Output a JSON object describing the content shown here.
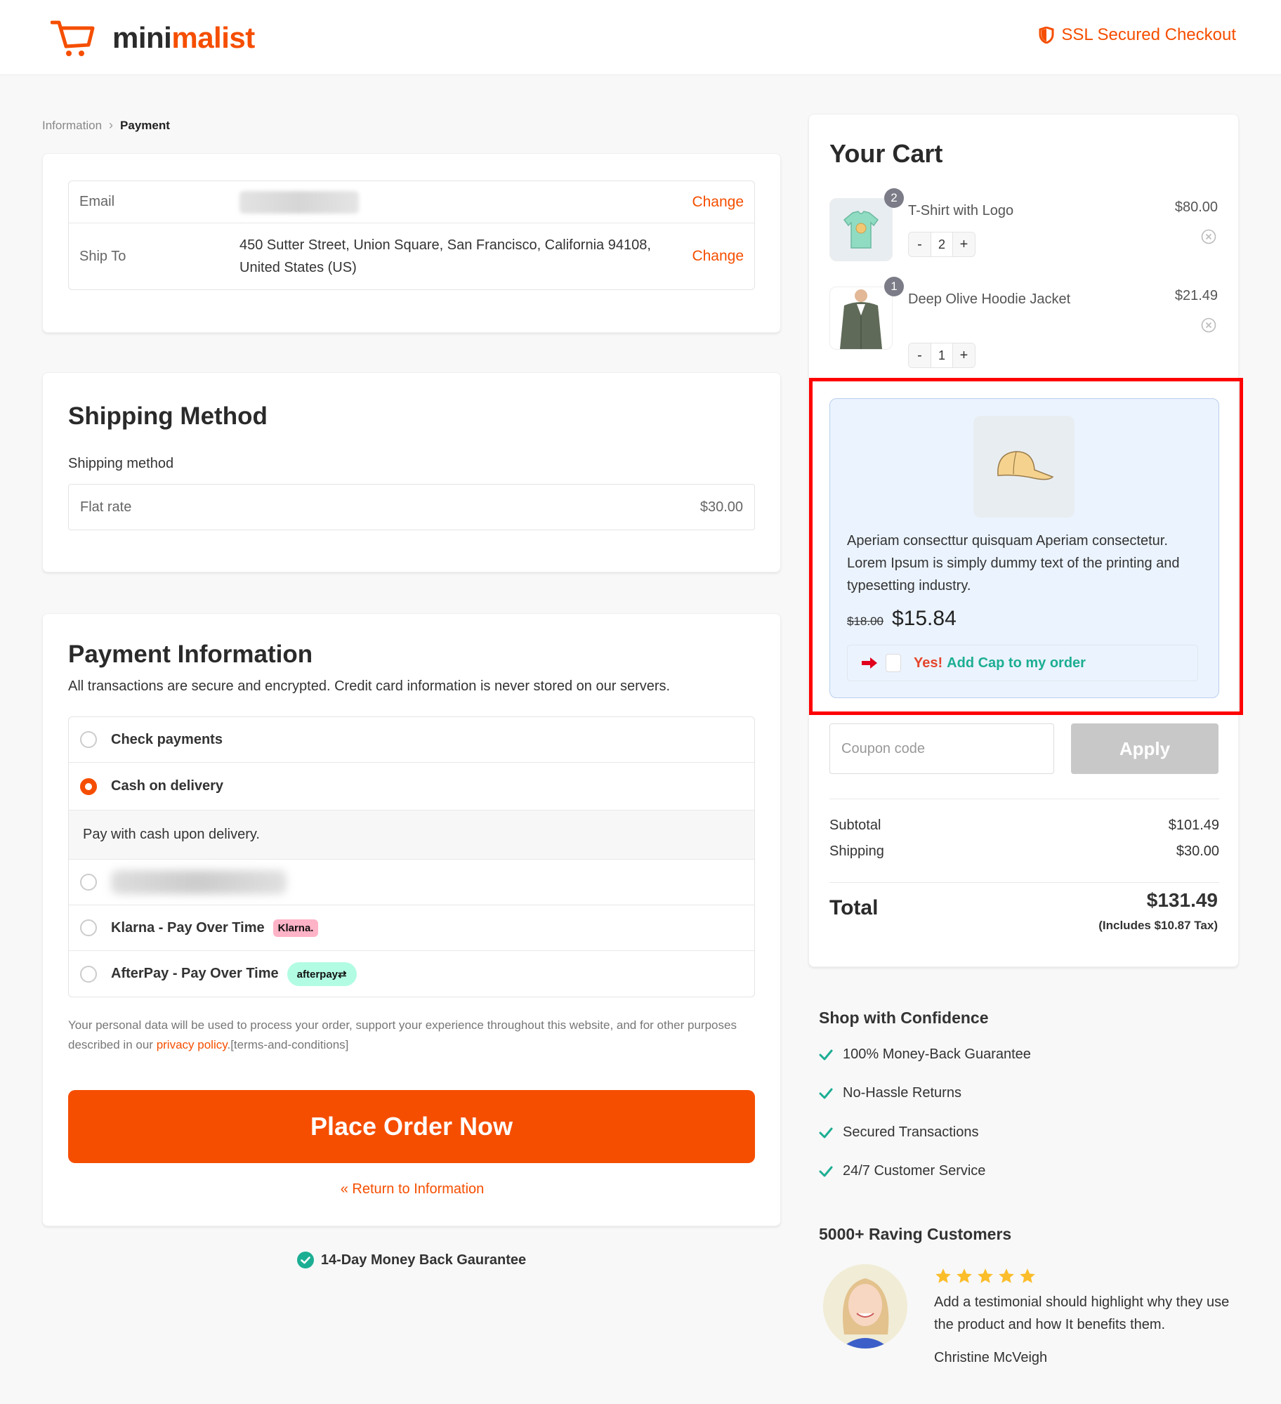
{
  "header": {
    "logo": {
      "part1": "mini",
      "part2": "malist"
    },
    "ssl_label": "SSL Secured Checkout"
  },
  "breadcrumb": [
    {
      "label": "Information",
      "active": false
    },
    {
      "label": "Payment",
      "active": true
    }
  ],
  "info": {
    "email_label": "Email",
    "ship_to_label": "Ship To",
    "ship_to_value": "450 Sutter Street, Union Square, San Francisco, California 94108, United States (US)",
    "change_label": "Change"
  },
  "shipping": {
    "title": "Shipping Method",
    "subtitle": "Shipping method",
    "method_name": "Flat rate",
    "method_price": "$30.00"
  },
  "payment": {
    "title": "Payment Information",
    "description": "All transactions are secure and encrypted. Credit card information is never stored on our servers.",
    "options": [
      {
        "label": "Check payments",
        "selected": false
      },
      {
        "label": "Cash on delivery",
        "selected": true,
        "detail": "Pay with cash upon delivery."
      },
      {
        "label": "",
        "selected": false,
        "blurred": true
      },
      {
        "label": "Klarna - Pay Over Time",
        "selected": false,
        "badge": "Klarna."
      },
      {
        "label": "AfterPay - Pay Over Time",
        "selected": false,
        "badge": "afterpay"
      }
    ],
    "privacy_prefix": "Your personal data will be used to process your order, support your experience throughout this website, and for other purposes described in our ",
    "privacy_link": "privacy policy",
    "privacy_suffix": ".[terms-and-conditions]",
    "place_order_label": "Place Order Now",
    "return_label": "« Return to Information"
  },
  "guarantee": "14-Day Money Back Gaurantee",
  "cart": {
    "title": "Your Cart",
    "items": [
      {
        "name": "T-Shirt with Logo",
        "price": "$80.00",
        "quantity": "2",
        "badge": "2"
      },
      {
        "name": "Deep Olive Hoodie Jacket",
        "price": "$21.49",
        "quantity": "1",
        "badge": "1"
      }
    ],
    "minus_label": "-",
    "plus_label": "+"
  },
  "upsell": {
    "description": "Aperiam consecttur quisquam Aperiam consectetur. Lorem Ipsum is simply dummy text of the printing and typesetting industry.",
    "old_price": "$18.00",
    "new_price": "$15.84",
    "cta_yes": "Yes!",
    "cta_add": "Add Cap to my order",
    "checked": false
  },
  "coupon": {
    "placeholder": "Coupon code",
    "value": "",
    "apply_label": "Apply"
  },
  "totals": {
    "subtotal_label": "Subtotal",
    "subtotal_value": "$101.49",
    "shipping_label": "Shipping",
    "shipping_value": "$30.00",
    "total_label": "Total",
    "total_value": "$131.49",
    "tax_note": "(Includes $10.87 Tax)"
  },
  "confidence": {
    "title": "Shop with Confidence",
    "items": [
      "100% Money-Back Guarantee",
      "No-Hassle Returns",
      "Secured Transactions",
      "24/7 Customer Service"
    ]
  },
  "reviews": {
    "title": "5000+ Raving Customers",
    "rating": 5,
    "rating_max": 5,
    "text": "Add a testimonial should highlight why they use the product and how It benefits them.",
    "author": "Christine McVeigh"
  },
  "colors": {
    "accent": "#f54e00",
    "success": "#1cae93",
    "highlight_border": "#ff0000",
    "star": "#fbbd2a"
  }
}
